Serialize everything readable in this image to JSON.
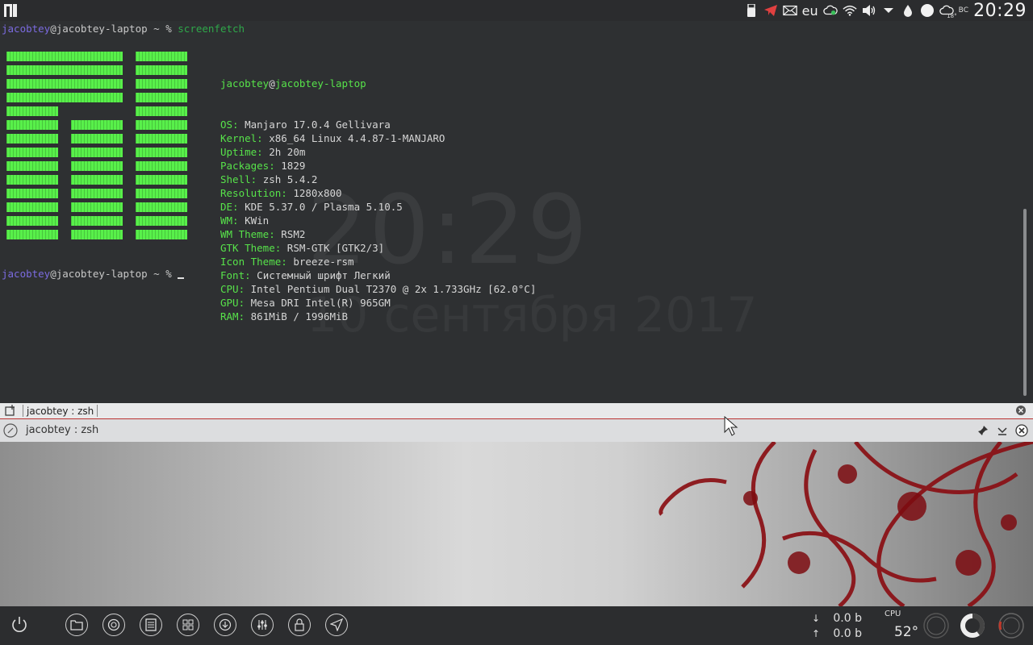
{
  "top_panel": {
    "layout": "eu",
    "weather_temp": "18°",
    "day": "ВС",
    "clock": "20:29"
  },
  "wallpaper_clock": {
    "time": "20:29",
    "date": "10 сентября 2017"
  },
  "terminal": {
    "prompt_user": "jacobtey",
    "prompt_host": "@jacobtey-laptop ~ % ",
    "command": "screenfetch",
    "header_user": "jacobtey",
    "header_host": "jacobtey-laptop",
    "info": [
      {
        "key": "OS:",
        "value": "Manjaro 17.0.4 Gellivara"
      },
      {
        "key": "Kernel:",
        "value": "x86_64 Linux 4.4.87-1-MANJARO"
      },
      {
        "key": "Uptime:",
        "value": "2h 20m"
      },
      {
        "key": "Packages:",
        "value": "1829"
      },
      {
        "key": "Shell:",
        "value": "zsh 5.4.2"
      },
      {
        "key": "Resolution:",
        "value": "1280x800"
      },
      {
        "key": "DE:",
        "value": "KDE 5.37.0 / Plasma 5.10.5"
      },
      {
        "key": "WM:",
        "value": "KWin"
      },
      {
        "key": "WM Theme:",
        "value": "RSM2"
      },
      {
        "key": "GTK Theme:",
        "value": "RSM-GTK [GTK2/3]"
      },
      {
        "key": "Icon Theme:",
        "value": "breeze-rsm"
      },
      {
        "key": "Font:",
        "value": "Системный шрифт Легкий"
      },
      {
        "key": "CPU:",
        "value": "Intel Pentium Dual T2370 @ 2x 1.733GHz [62.0°C]"
      },
      {
        "key": "GPU:",
        "value": "Mesa DRI Intel(R) 965GM"
      },
      {
        "key": "RAM:",
        "value": "861MiB / 1996MiB"
      }
    ]
  },
  "tab": {
    "label": "jacobtey : zsh"
  },
  "window": {
    "title": "jacobtey : zsh"
  },
  "bottom_panel": {
    "net_down": "0.0 b",
    "net_up": "0.0 b",
    "down_arrow": "↓",
    "up_arrow": "↑",
    "cpu_label": "CPU",
    "cpu_temp": "52°"
  },
  "colors": {
    "accent": "#58f04a",
    "prompt_user": "#7b6be0",
    "tab_border": "#bb3333"
  }
}
